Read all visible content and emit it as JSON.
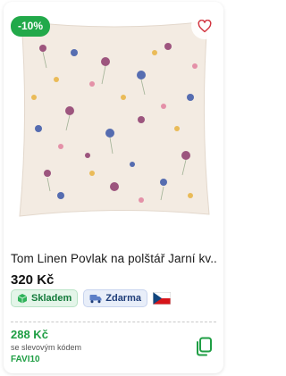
{
  "product": {
    "discount_badge": "-10%",
    "title": "Tom Linen Povlak na polštář Jarní kv...",
    "price": "320 Kč",
    "tags": {
      "stock_label": "Skladem",
      "shipping_label": "Zdarma",
      "country_flag": "czech-flag"
    },
    "promo": {
      "price": "288 Kč",
      "note": "se slevovým kódem",
      "code": "FAVI10"
    }
  },
  "colors": {
    "accent_green": "#22a94a",
    "favorite_red": "#d2343f",
    "shipping_blue": "#1d3c78"
  },
  "icons": {
    "favorite": "heart-icon",
    "stock": "box-icon",
    "shipping": "truck-icon",
    "copy": "copy-icon"
  }
}
